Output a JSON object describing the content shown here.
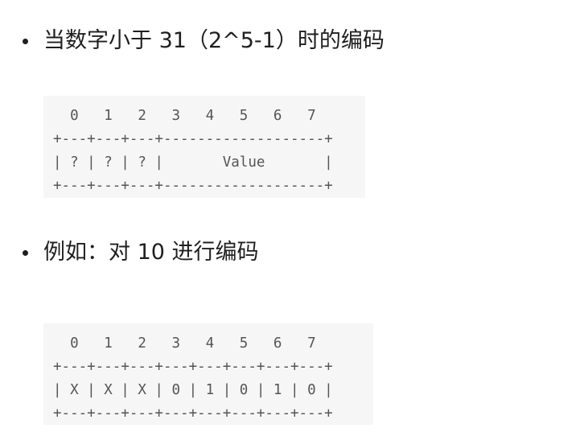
{
  "section1": {
    "heading": "当数字小于 31（2^5-1）时的编码",
    "code_lines": [
      "  0   1   2   3   4   5   6   7",
      "+---+---+---+-------------------+",
      "| ? | ? | ? |       Value       |",
      "+---+---+---+-------------------+"
    ]
  },
  "section2": {
    "heading": "例如：对 10 进行编码",
    "code_lines": [
      "  0   1   2   3   4   5   6   7",
      "+---+---+---+---+---+---+---+---+",
      "| X | X | X | 0 | 1 | 0 | 1 | 0 |",
      "+---+---+---+---+---+---+---+---+"
    ]
  }
}
